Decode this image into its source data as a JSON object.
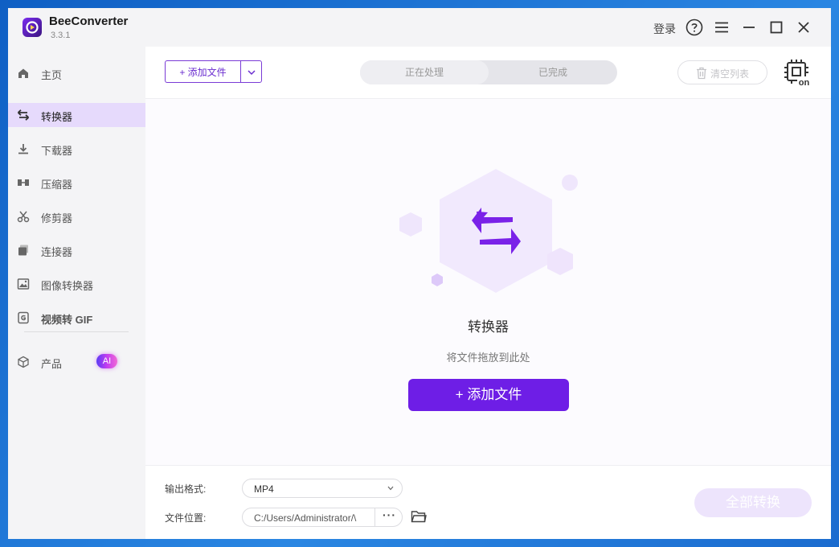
{
  "app": {
    "name": "BeeConverter",
    "version": "3.3.1",
    "login": "登录",
    "accent_color": "#6e1ee6"
  },
  "titlebar_icons": [
    "help-icon",
    "menu-icon",
    "minimize-icon",
    "maximize-icon",
    "close-icon"
  ],
  "sidebar": {
    "items": [
      {
        "label": "主页",
        "icon": "home-icon",
        "active": false
      },
      {
        "label": "转换器",
        "icon": "convert-arrows-icon",
        "active": true
      },
      {
        "label": "下载器",
        "icon": "download-icon",
        "active": false
      },
      {
        "label": "压缩器",
        "icon": "compress-icon",
        "active": false
      },
      {
        "label": "修剪器",
        "icon": "scissors-icon",
        "active": false
      },
      {
        "label": "连接器",
        "icon": "merge-icon",
        "active": false
      },
      {
        "label": "图像转换器",
        "icon": "image-icon",
        "active": false
      },
      {
        "label": "视频转 GIF",
        "icon": "gif-icon",
        "active": false
      }
    ],
    "products": {
      "label": "产品",
      "icon": "cube-icon",
      "badge": "AI"
    }
  },
  "toolbar": {
    "add_file": "+ 添加文件",
    "tabs": [
      "正在处理",
      "已完成"
    ],
    "active_tab": "正在处理",
    "clear_list": "清空列表",
    "hw_accel_label": "on"
  },
  "empty_state": {
    "title": "转换器",
    "hint": "将文件拖放到此处",
    "add_button": "+ 添加文件"
  },
  "footer": {
    "output_format_label": "输出格式:",
    "output_format_value": "MP4",
    "file_location_label": "文件位置:",
    "file_location_value": "C:/Users/Administrator/\\",
    "more_button": "···",
    "convert_all": "全部转换"
  }
}
